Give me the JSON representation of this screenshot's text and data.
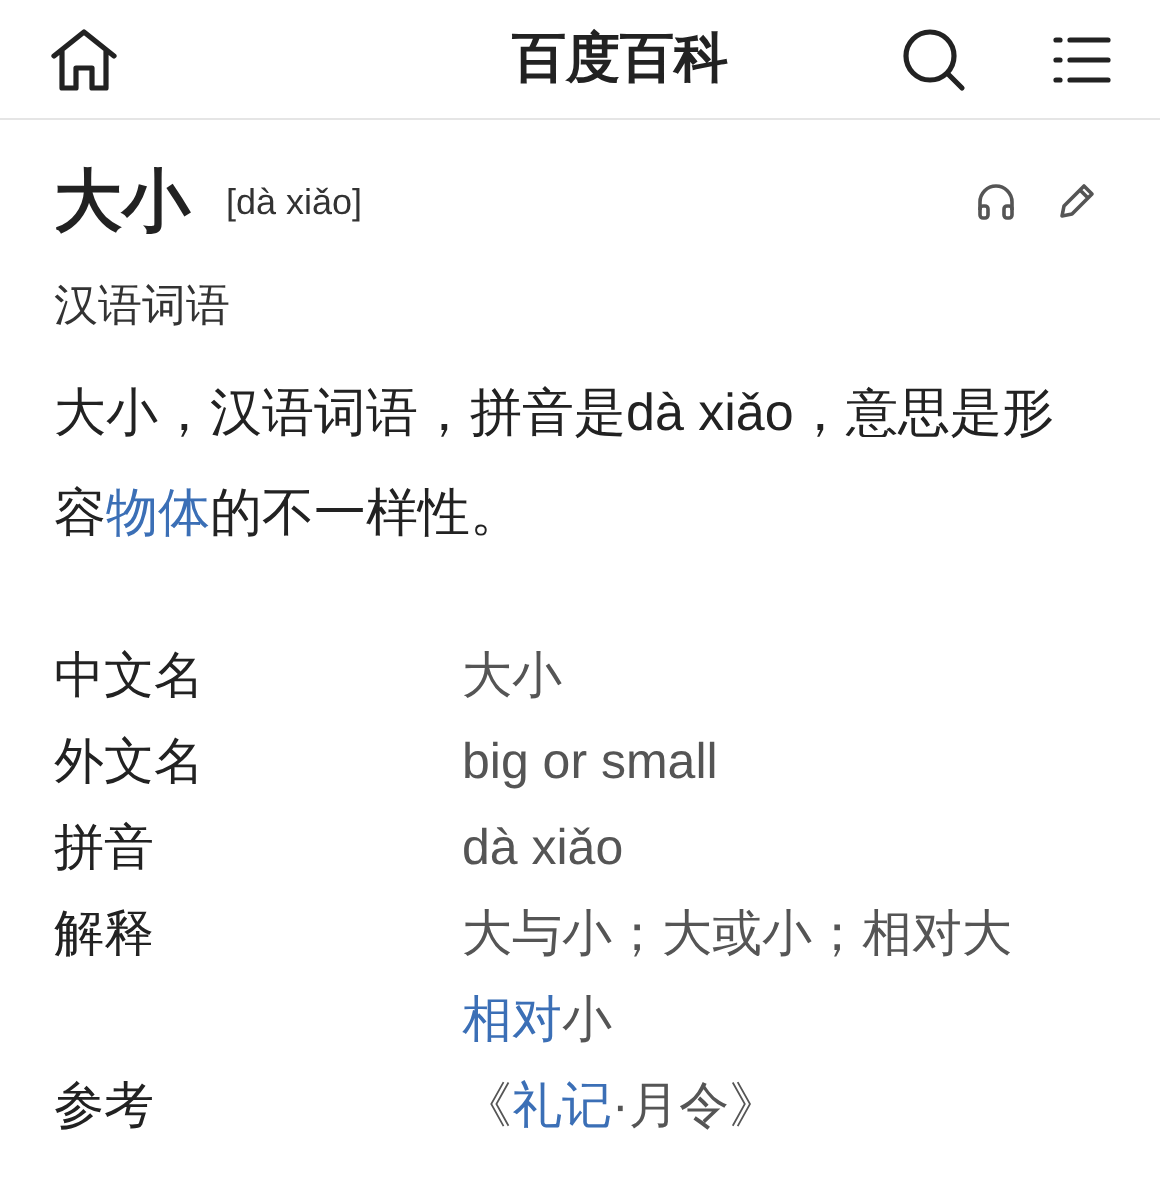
{
  "header": {
    "title": "百度百科"
  },
  "entry": {
    "title": "大小",
    "pinyin": "[dà xiǎo]",
    "category": "汉语词语",
    "summary": [
      {
        "kind": "text",
        "text": "大小，汉语词语，拼音是dà xiǎo，意思是形容"
      },
      {
        "kind": "link",
        "text": "物体"
      },
      {
        "kind": "text",
        "text": "的不一样性。"
      }
    ]
  },
  "infobox": [
    {
      "label": "中文名",
      "value": [
        {
          "kind": "text",
          "text": "大小"
        }
      ]
    },
    {
      "label": "外文名",
      "value": [
        {
          "kind": "text",
          "text": "big or small"
        }
      ]
    },
    {
      "label": "拼音",
      "value": [
        {
          "kind": "text",
          "text": "dà xiǎo"
        }
      ]
    },
    {
      "label": "解释",
      "value": [
        {
          "kind": "text",
          "text": "大与小；大或小；相对大"
        },
        {
          "kind": "link",
          "text": "相对"
        },
        {
          "kind": "text",
          "text": "小"
        }
      ]
    },
    {
      "label": "参考",
      "value": [
        {
          "kind": "text",
          "text": "《"
        },
        {
          "kind": "link",
          "text": "礼记"
        },
        {
          "kind": "text",
          "text": "·月令》"
        }
      ]
    }
  ]
}
